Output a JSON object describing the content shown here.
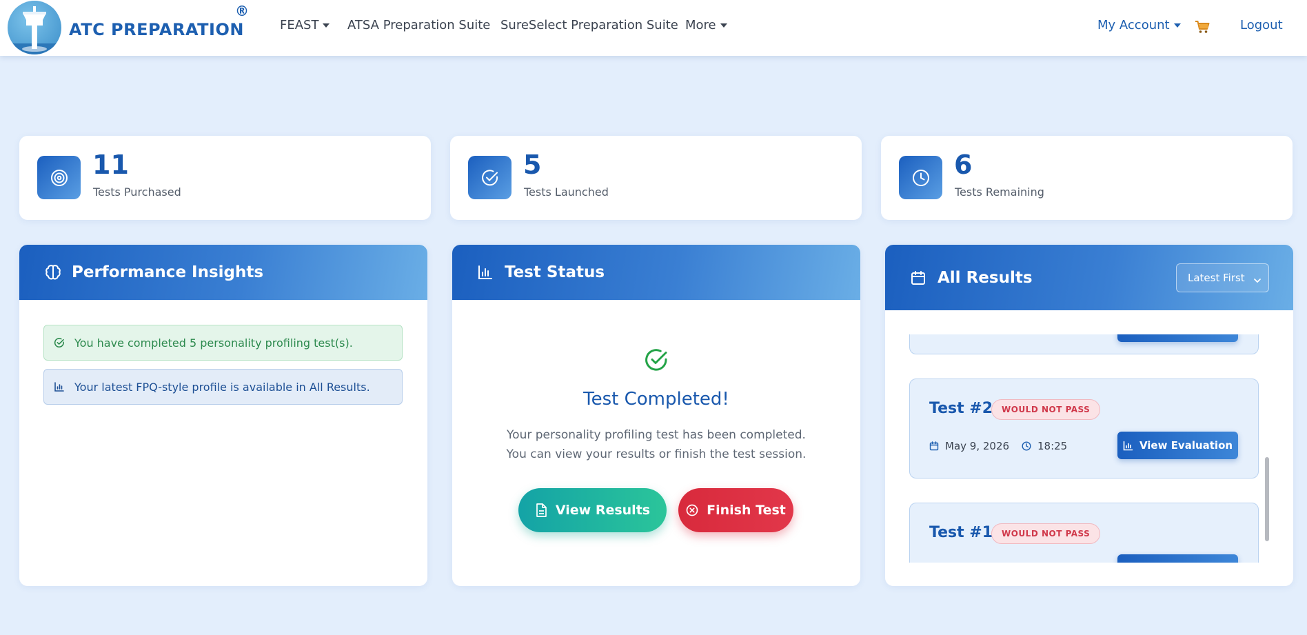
{
  "brand": {
    "name": "ATC PREPARATION",
    "registered": "®"
  },
  "nav": {
    "items": [
      {
        "label": "FEAST",
        "dropdown": true
      },
      {
        "label": "ATSA Preparation Suite",
        "dropdown": false
      },
      {
        "label": "SureSelect Preparation Suite",
        "dropdown": false
      },
      {
        "label": "More",
        "dropdown": true
      }
    ],
    "account": "My Account",
    "cart_icon": "cart-icon",
    "logout": "Logout"
  },
  "stats": [
    {
      "value": "11",
      "label": "Tests Purchased",
      "icon": "target-icon"
    },
    {
      "value": "5",
      "label": "Tests Launched",
      "icon": "check-circle-icon"
    },
    {
      "value": "6",
      "label": "Tests Remaining",
      "icon": "clock-icon"
    }
  ],
  "insights": {
    "title": "Performance Insights",
    "alerts": [
      {
        "type": "success",
        "text": "You have completed 5 personality profiling test(s)."
      },
      {
        "type": "info",
        "text": "Your latest FPQ-style profile is available in All Results."
      }
    ]
  },
  "test_status": {
    "title": "Test Status",
    "heading": "Test Completed!",
    "description": "Your personality profiling test has been completed. You can view your results or finish the test session.",
    "view_results": "View Results",
    "finish_test": "Finish Test"
  },
  "results": {
    "title": "All Results",
    "sort_selected": "Latest First",
    "items": [
      {
        "title": "Test #2",
        "status": "WOULD NOT PASS",
        "date": "May 9, 2026",
        "time": "18:25",
        "action": "View Evaluation"
      },
      {
        "title": "Test #1",
        "status": "WOULD NOT PASS",
        "date": "",
        "time": "",
        "action": ""
      }
    ]
  },
  "colors": {
    "primary": "#1b5fbf",
    "background": "#e3eefc",
    "success": "#2d8a4e",
    "danger": "#d82a3c",
    "teal": "#14a3a6"
  }
}
